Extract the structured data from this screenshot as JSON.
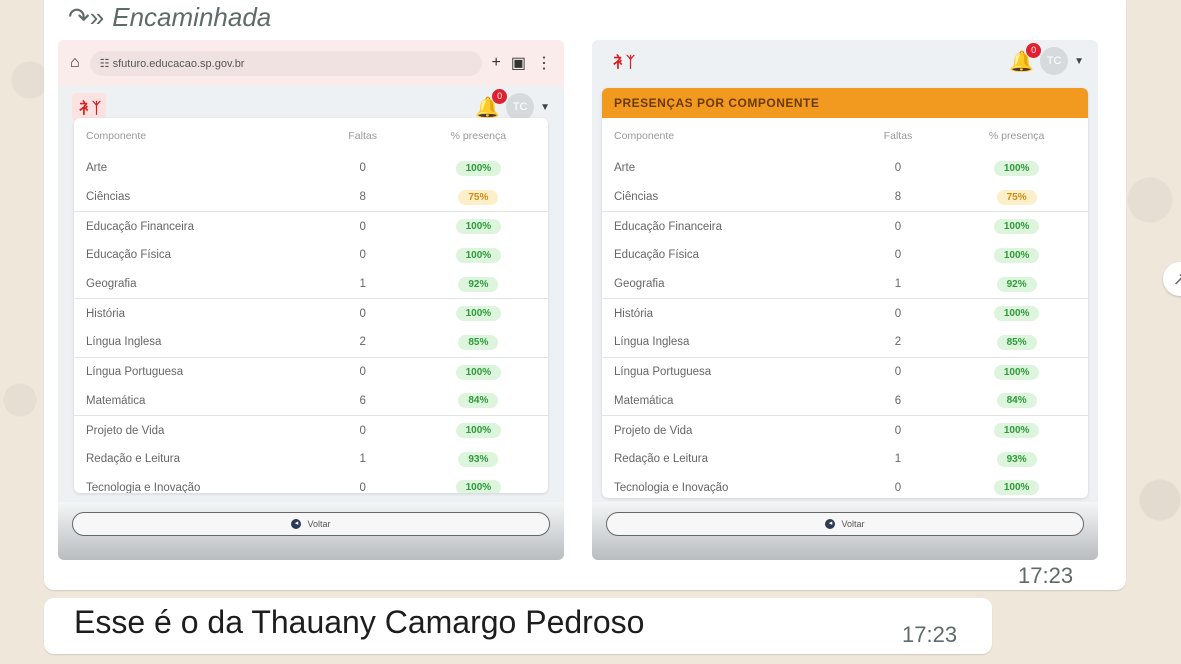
{
  "chat": {
    "forward_label": "Encaminhada",
    "forward_icon": "forward-icon",
    "time1": "17:23",
    "message2": "Esse é o da Thauany Camargo Pedroso",
    "time2": "17:23"
  },
  "left_screenshot": {
    "url": "sfuturo.educacao.sp.gov.br",
    "bell_count": "0",
    "avatar": "TC",
    "button_label": "Voltar"
  },
  "right_screenshot": {
    "card_title": "PRESENÇAS POR COMPONENTE",
    "bell_count": "0",
    "avatar": "TC",
    "button_label": "Voltar"
  },
  "table": {
    "headers": {
      "component": "Componente",
      "faltas": "Faltas",
      "presenca": "% presença"
    },
    "rows": [
      {
        "name": "Arte",
        "faltas": "0",
        "presenca": "100%"
      },
      {
        "name": "Ciências",
        "faltas": "8",
        "presenca": "75%"
      },
      {
        "name": "Educação Financeira",
        "faltas": "0",
        "presenca": "100%"
      },
      {
        "name": "Educação Física",
        "faltas": "0",
        "presenca": "100%"
      },
      {
        "name": "Geografia",
        "faltas": "1",
        "presenca": "92%"
      },
      {
        "name": "História",
        "faltas": "0",
        "presenca": "100%"
      },
      {
        "name": "Língua Inglesa",
        "faltas": "2",
        "presenca": "85%"
      },
      {
        "name": "Língua Portuguesa",
        "faltas": "0",
        "presenca": "100%"
      },
      {
        "name": "Matemática",
        "faltas": "6",
        "presenca": "84%"
      },
      {
        "name": "Projeto de Vida",
        "faltas": "0",
        "presenca": "100%"
      },
      {
        "name": "Redação e Leitura",
        "faltas": "1",
        "presenca": "93%"
      },
      {
        "name": "Tecnologia e Inovação",
        "faltas": "0",
        "presenca": "100%"
      }
    ]
  },
  "colors": {
    "accent_orange": "#f29a1f",
    "ok_green": "#2f9a3a",
    "warn_orange": "#d48a10",
    "logo_red": "#d42020"
  }
}
